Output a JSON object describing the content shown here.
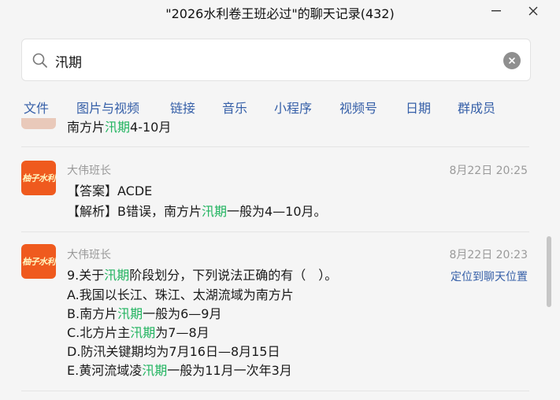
{
  "window": {
    "title": "\"2026水利卷王班必过\"的聊天记录(432)"
  },
  "search": {
    "value": "汛期"
  },
  "tabs": [
    "文件",
    "图片与视频",
    "链接",
    "音乐",
    "小程序",
    "视频号",
    "日期",
    "群成员"
  ],
  "messages": [
    {
      "partial": true,
      "segments": [
        [
          "南方片",
          ""
        ],
        [
          "汛期",
          "hl"
        ],
        [
          "4-10月",
          ""
        ]
      ]
    },
    {
      "avatar_text": "柚子水利",
      "sender": "大伟班长",
      "time": "8月22日 20:25",
      "lines": [
        [
          [
            "【答案】ACDE",
            ""
          ]
        ],
        [
          [
            "【解析】B错误，南方片",
            ""
          ],
          [
            "汛期",
            "hl"
          ],
          [
            "一般为4—10月。",
            ""
          ]
        ]
      ]
    },
    {
      "avatar_text": "柚子水利",
      "sender": "大伟班长",
      "time": "8月22日 20:23",
      "locate_label": "定位到聊天位置",
      "lines": [
        [
          [
            "9.关于",
            ""
          ],
          [
            "汛期",
            "hl"
          ],
          [
            "阶段划分，下列说法正确的有（　）。",
            ""
          ]
        ],
        [
          [
            "A.我国以长江、珠江、太湖流域为南方片",
            ""
          ]
        ],
        [
          [
            "B.南方片",
            ""
          ],
          [
            "汛期",
            "hl"
          ],
          [
            "一般为6—9月",
            ""
          ]
        ],
        [
          [
            "C.北方片主",
            ""
          ],
          [
            "汛期",
            "hl"
          ],
          [
            "为7—8月",
            ""
          ]
        ],
        [
          [
            "D.防汛关键期均为7月16日—8月15日",
            ""
          ]
        ],
        [
          [
            "E.黄河流域凌",
            ""
          ],
          [
            "汛期",
            "hl"
          ],
          [
            "一般为11月一次年3月",
            ""
          ]
        ]
      ]
    }
  ],
  "colors": {
    "highlight": "#1fb35e",
    "link": "#355fa8",
    "avatar_bg": "#ef5a1e"
  },
  "scroll": {
    "thumb_fraction_start": 0.42,
    "thumb_fraction_size": 0.25
  }
}
